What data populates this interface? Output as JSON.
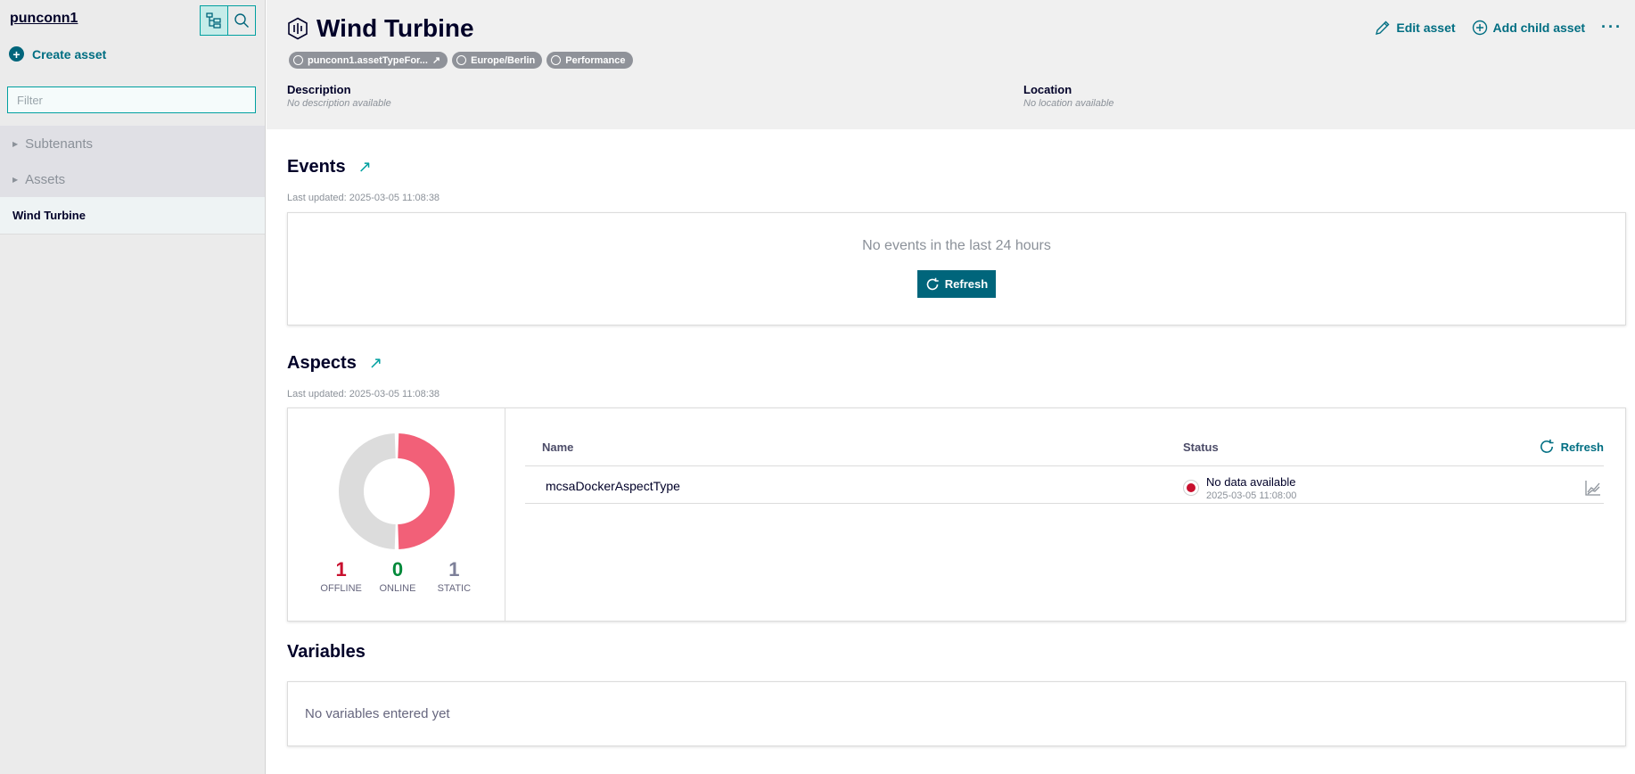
{
  "sidebar": {
    "tenant": "punconn1",
    "create_asset": "Create asset",
    "filter_placeholder": "Filter",
    "tree": [
      {
        "label": "Subtenants"
      },
      {
        "label": "Assets"
      },
      {
        "label": "Wind Turbine"
      }
    ],
    "icons": {
      "tree_view": "tree-view-icon",
      "search": "search-icon",
      "create": "plus-circle-icon"
    }
  },
  "header": {
    "title": "Wind Turbine",
    "badges": [
      "punconn1.assetTypeFor...",
      "Europe/Berlin",
      "Performance"
    ],
    "description_label": "Description",
    "description_value": "No description available",
    "location_label": "Location",
    "location_value": "No location available",
    "edit_asset": "Edit asset",
    "add_child_asset": "Add child asset",
    "more": "···"
  },
  "events": {
    "title": "Events",
    "last_updated": "Last updated: 2025-03-05 11:08:38",
    "empty_text": "No events in the last 24 hours",
    "refresh_label": "Refresh"
  },
  "aspects": {
    "title": "Aspects",
    "last_updated": "Last updated: 2025-03-05 11:08:38",
    "stats": [
      {
        "value": "1",
        "label": "OFFLINE",
        "color": "#c8102e"
      },
      {
        "value": "0",
        "label": "ONLINE",
        "color": "#01893a"
      },
      {
        "value": "1",
        "label": "STATIC",
        "color": "#7d8099"
      }
    ],
    "donut": {
      "offline_fraction": 0.5,
      "offline_color": "#f26078",
      "static_color": "#dcdcdc"
    },
    "columns": {
      "name": "Name",
      "status": "Status"
    },
    "refresh_label": "Refresh",
    "rows": [
      {
        "name": "mcsaDockerAspectType",
        "status": "No data available",
        "time": "2025-03-05 11:08:00"
      }
    ]
  },
  "variables": {
    "title": "Variables",
    "empty_text": "No variables entered yet"
  },
  "colors": {
    "accent": "#006e82",
    "primary_button": "#00657b",
    "offline": "#c8102e"
  }
}
